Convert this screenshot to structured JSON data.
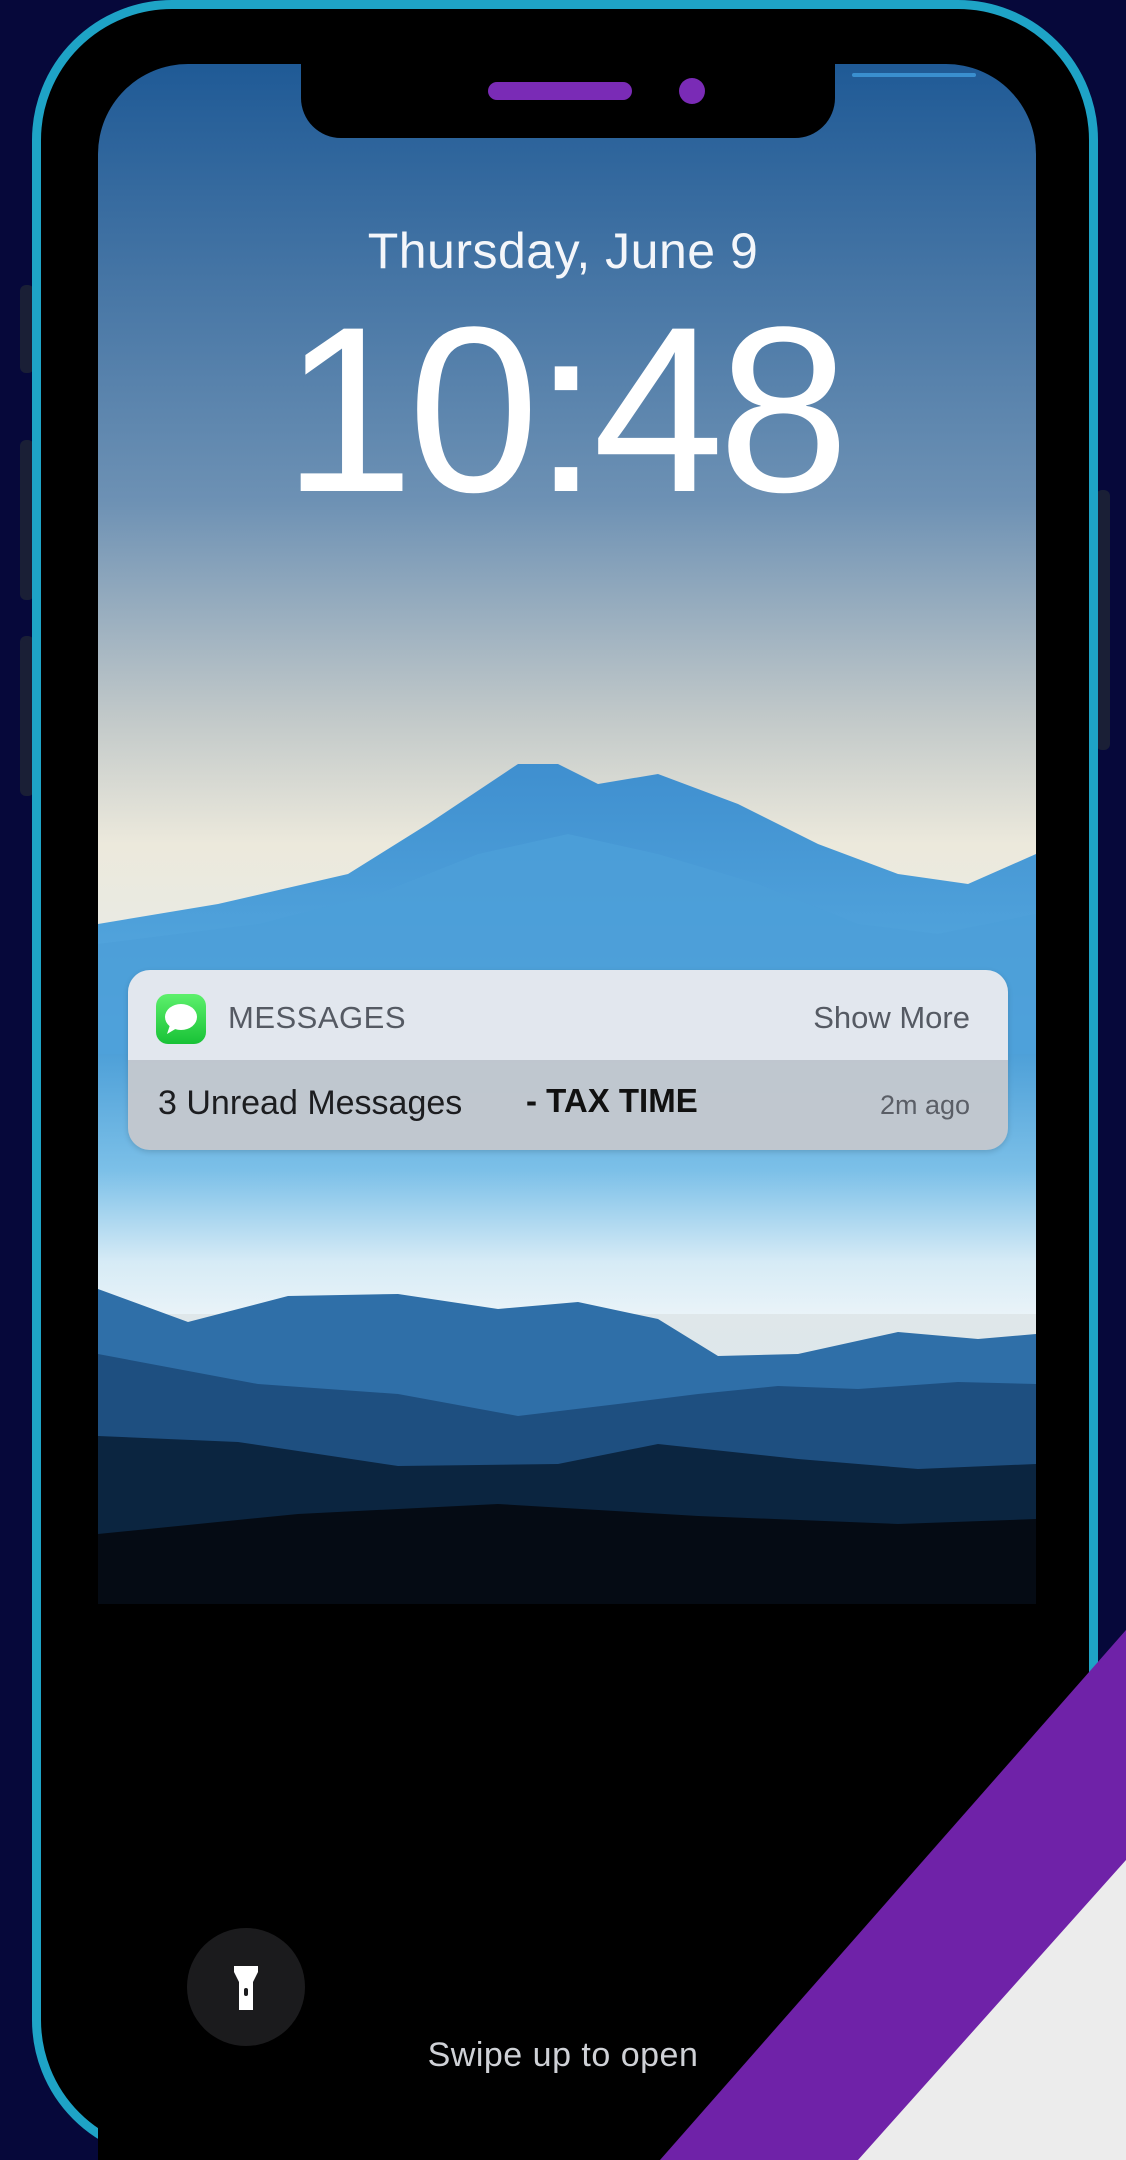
{
  "lockscreen": {
    "date": "Thursday, June 9",
    "time": "10:48",
    "swipe_hint": "Swipe up to open"
  },
  "notification": {
    "app_name": "MESSAGES",
    "show_more": "Show More",
    "message": "3 Unread Messages",
    "tag": "- TAX TIME",
    "timestamp": "2m ago",
    "app_icon": "messages-bubble-icon"
  },
  "controls": {
    "flashlight_icon": "flashlight-icon"
  },
  "colors": {
    "frame": "#1ea3c6",
    "background": "#06083a",
    "accent": "#6f22a8",
    "notch_accent": "#7a2bb6",
    "messages_green": "#2fd54a"
  }
}
